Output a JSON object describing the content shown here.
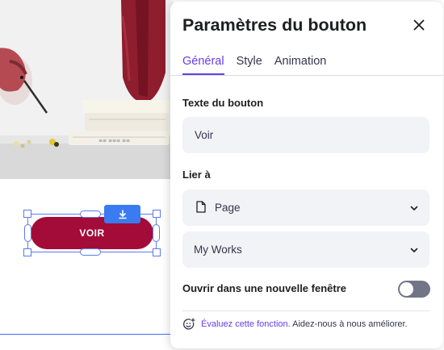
{
  "panel": {
    "title": "Paramètres du bouton",
    "tabs": [
      {
        "label": "Général",
        "active": true
      },
      {
        "label": "Style",
        "active": false
      },
      {
        "label": "Animation",
        "active": false
      }
    ],
    "button_text": {
      "label": "Texte du bouton",
      "value": "Voir"
    },
    "link": {
      "label": "Lier à",
      "type_value": "Page",
      "type_icon": "document-icon",
      "page_value": "My Works"
    },
    "new_window": {
      "label": "Ouvrir dans une nouvelle fenêtre",
      "enabled": false
    },
    "feedback": {
      "icon": "smiley-plus-icon",
      "link_text": "Évaluez cette fonction.",
      "text": " Aidez-nous à nous améliorer."
    }
  },
  "canvas": {
    "button_label": "VOIR",
    "button_color": "#a30b38",
    "download_icon": "download-icon"
  },
  "colors": {
    "accent": "#673de6",
    "selection": "#5b7bf0",
    "download_button": "#3a7bf1",
    "toggle_off": "#727586"
  }
}
